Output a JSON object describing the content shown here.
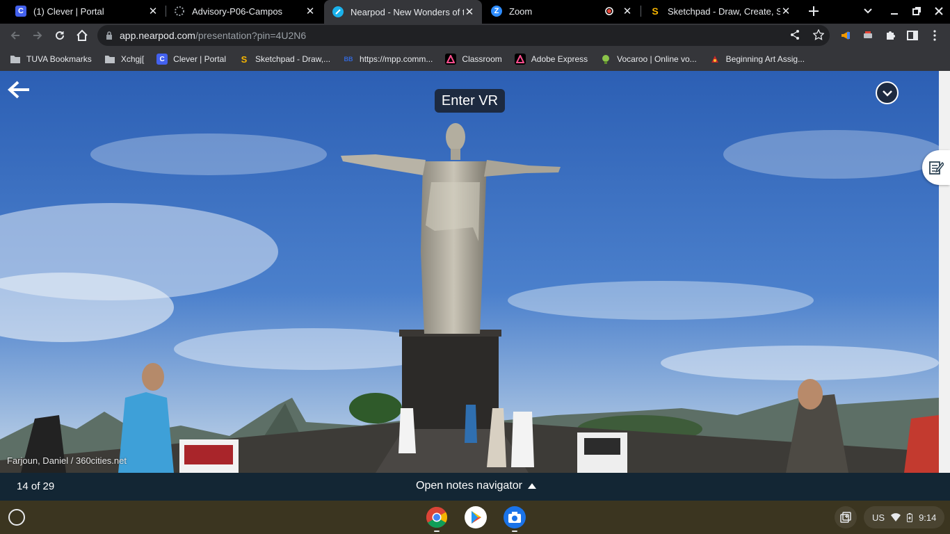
{
  "tabs": [
    {
      "title": "(1) Clever | Portal",
      "icon": "clever-icon",
      "color": "#4361ee"
    },
    {
      "title": "Advisory-P06-Campos",
      "icon": "loading-spinner-icon"
    },
    {
      "title": "Nearpod - New Wonders of the",
      "icon": "nearpod-icon",
      "color": "#1ab2ec",
      "active": true
    },
    {
      "title": "Zoom",
      "icon": "zoom-icon",
      "color": "#2d8cff"
    },
    {
      "title": "",
      "icon": "recording-icon",
      "color": "#e84436"
    },
    {
      "title": "Sketchpad - Draw, Create, Sha",
      "icon": "sketchpad-icon"
    }
  ],
  "address_bar": {
    "host": "app.nearpod.com",
    "path": "/presentation?pin=4U2N6"
  },
  "bookmarks": [
    {
      "label": "TUVA Bookmarks",
      "icon": "folder-icon"
    },
    {
      "label": "Xchgj[",
      "icon": "folder-icon"
    },
    {
      "label": "Clever | Portal",
      "icon": "clever-icon"
    },
    {
      "label": "Sketchpad - Draw,...",
      "icon": "sketchpad-icon"
    },
    {
      "label": "https://mpp.comm...",
      "icon": "mpp-icon"
    },
    {
      "label": "Classroom",
      "icon": "adobe-icon"
    },
    {
      "label": "Adobe Express",
      "icon": "adobe-icon"
    },
    {
      "label": "Vocaroo | Online vo...",
      "icon": "vocaroo-icon"
    },
    {
      "label": "Beginning Art Assig...",
      "icon": "art-icon"
    }
  ],
  "viewer": {
    "enter_vr_label": "Enter VR",
    "credit": "Farjoun, Daniel / 360cities.net"
  },
  "nearpod_bar": {
    "slide_counter": "14 of 29",
    "notes_navigator_label": "Open notes navigator"
  },
  "shelf": {
    "apps": [
      "chrome-icon",
      "play-store-icon",
      "camera-icon"
    ],
    "locale": "US",
    "time": "9:14"
  }
}
